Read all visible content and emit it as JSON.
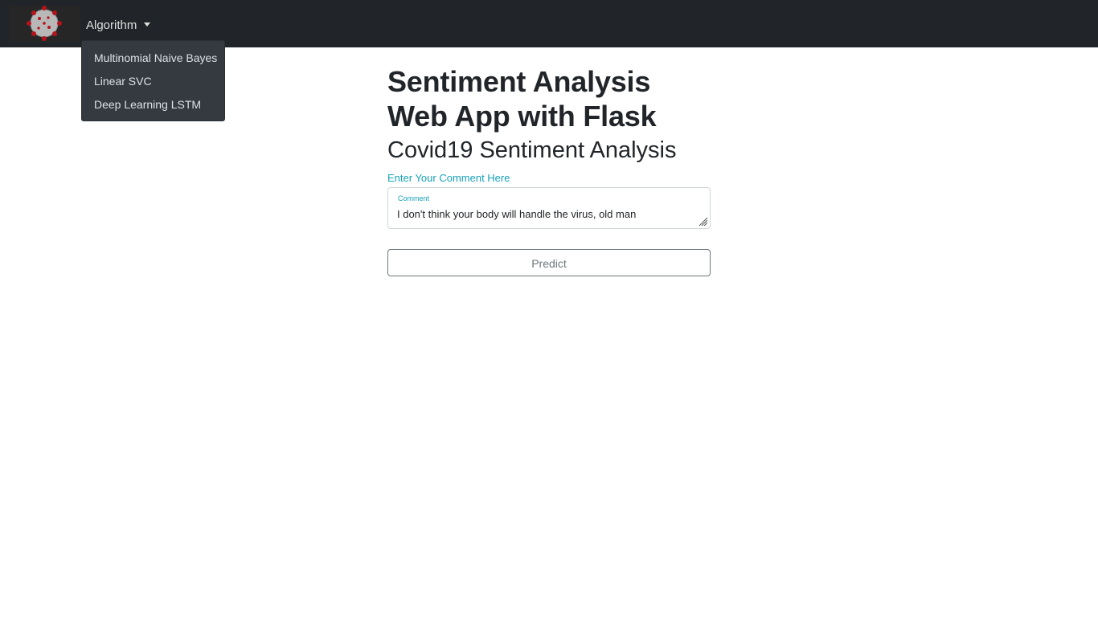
{
  "navbar": {
    "logo": "coronavirus-logo",
    "dropdown": {
      "label": "Algorithm",
      "items": [
        {
          "label": "Multinomial Naive Bayes"
        },
        {
          "label": "Linear SVC"
        },
        {
          "label": "Deep Learning LSTM"
        }
      ]
    }
  },
  "main": {
    "title_line1": "Sentiment Analysis",
    "title_line2": "Web App with Flask",
    "subtitle": "Covid19 Sentiment Analysis",
    "field_label": "Enter Your Comment Here",
    "comment": {
      "floating_label": "Comment",
      "value": "I don't think your body will handle the virus, old man"
    },
    "predict_label": "Predict"
  },
  "colors": {
    "navbar": "#212529",
    "dropdown": "#343a40",
    "accent": "#17a2b8",
    "button_border": "#6c757d"
  }
}
